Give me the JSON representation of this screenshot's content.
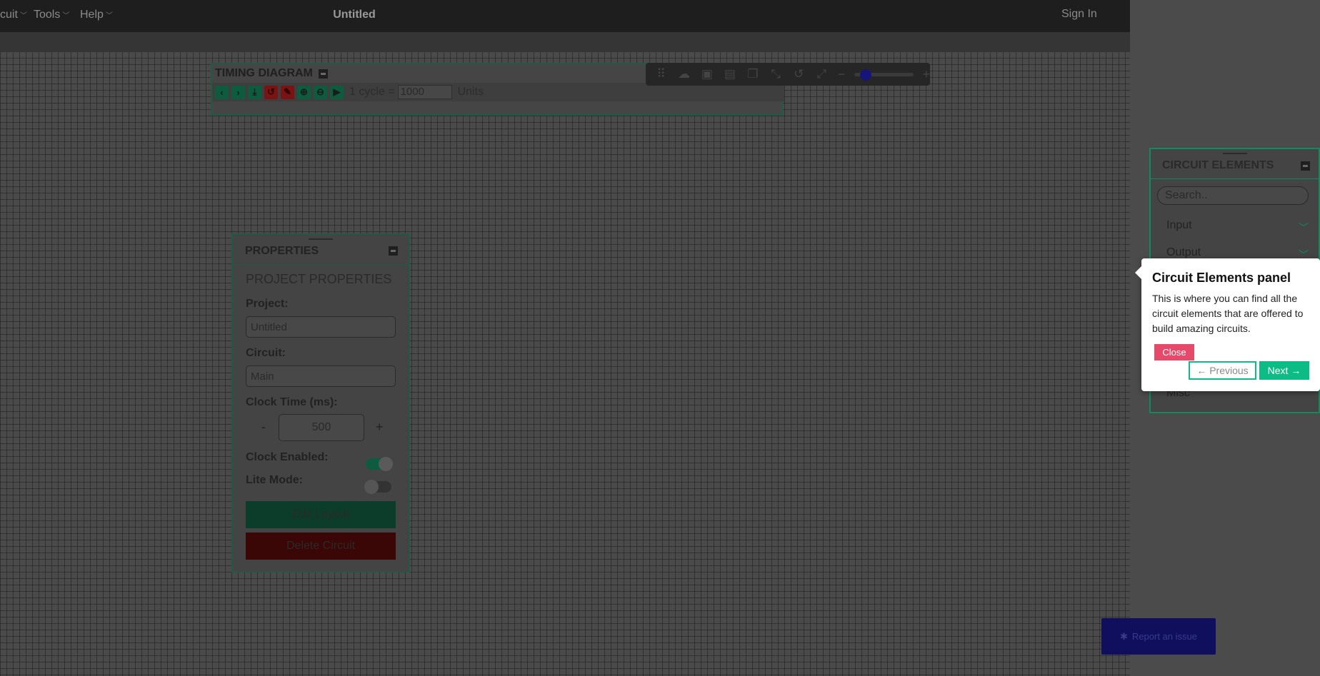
{
  "navbar": {
    "menus": [
      {
        "label": "cuit"
      },
      {
        "label": "Tools"
      },
      {
        "label": "Help"
      }
    ],
    "title": "Untitled",
    "sign_in": "Sign In"
  },
  "timing_diagram": {
    "title": "TIMING DIAGRAM",
    "cycle_label": "1 cycle =",
    "cycle_value": "1000",
    "units_label": "Units",
    "buttons": [
      "chevron-left-icon",
      "chevron-right-icon",
      "download-icon",
      "reset-icon",
      "brush-icon",
      "zoom-in-icon",
      "zoom-out-icon",
      "play-icon"
    ]
  },
  "canvas_toolbar": {
    "icons": [
      "drag-icon",
      "cloud-upload-icon",
      "save-icon",
      "delete-icon",
      "copy-icon",
      "fit-icon",
      "undo-icon",
      "fullscreen-icon"
    ],
    "zoom_minus": "−",
    "zoom_plus": "+"
  },
  "properties": {
    "title": "PROPERTIES",
    "heading": "PROJECT PROPERTIES",
    "project_label": "Project:",
    "project_value": "Untitled",
    "circuit_label": "Circuit:",
    "circuit_value": "Main",
    "clock_time_label": "Clock Time (ms):",
    "clock_minus": "-",
    "clock_time_value": "500",
    "clock_plus": "+",
    "clock_enabled_label": "Clock Enabled:",
    "clock_enabled": true,
    "lite_mode_label": "Lite Mode:",
    "lite_mode": false,
    "edit_layout": "Edit Layout",
    "delete_circuit": "Delete Circuit"
  },
  "circuit_elements": {
    "title": "CIRCUIT ELEMENTS",
    "search_placeholder": "Search..",
    "categories": [
      {
        "label": "Input"
      },
      {
        "label": "Output"
      }
    ],
    "misc": "Misc"
  },
  "popover": {
    "title": "Circuit Elements panel",
    "description": "This is where you can find all the circuit elements that are offered to build amazing circuits.",
    "close": "Close",
    "previous": "← Previous",
    "next": "Next →"
  },
  "report": {
    "label": "Report an issue"
  },
  "colors": {
    "accent_green": "#0dbb85",
    "close_red": "#e64a6a",
    "report_blue": "#0f0f5e"
  }
}
